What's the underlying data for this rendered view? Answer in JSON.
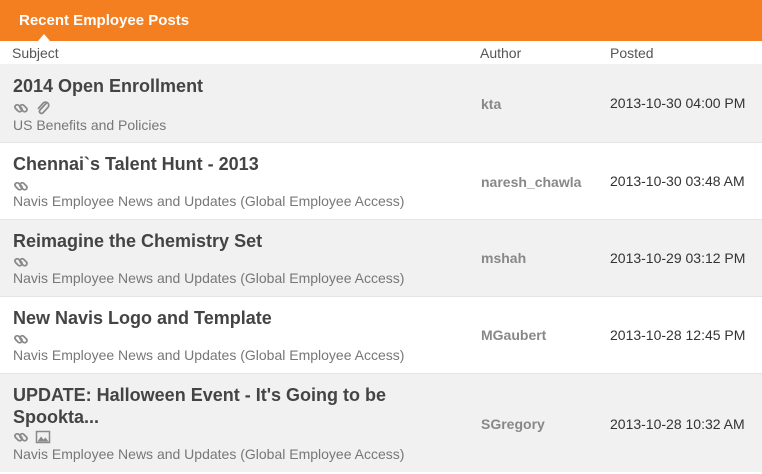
{
  "widget": {
    "title": "Recent Employee Posts",
    "accent_color": "#f47f20"
  },
  "columns": {
    "subject": "Subject",
    "author": "Author",
    "posted": "Posted"
  },
  "posts": [
    {
      "title": "2014 Open Enrollment",
      "category": "US Benefits and Policies",
      "author": "kta",
      "posted": "2013-10-30 04:00 PM",
      "icons": [
        "link-icon",
        "attachment-icon"
      ]
    },
    {
      "title": "Chennai`s Talent Hunt - 2013",
      "category": "Navis Employee News and Updates (Global Employee Access)",
      "author": "naresh_chawla",
      "posted": "2013-10-30 03:48 AM",
      "icons": [
        "link-icon"
      ]
    },
    {
      "title": "Reimagine the Chemistry Set",
      "category": "Navis Employee News and Updates (Global Employee Access)",
      "author": "mshah",
      "posted": "2013-10-29 03:12 PM",
      "icons": [
        "link-icon"
      ]
    },
    {
      "title": "New Navis Logo and Template",
      "category": "Navis Employee News and Updates (Global Employee Access)",
      "author": "MGaubert",
      "posted": "2013-10-28 12:45 PM",
      "icons": [
        "link-icon"
      ]
    },
    {
      "title_line1": "UPDATE: Halloween Event - It's Going to be",
      "title_line2": "Spookta...",
      "category": "Navis Employee News and Updates (Global Employee Access)",
      "author": "SGregory",
      "posted": "2013-10-28 10:32 AM",
      "icons": [
        "link-icon",
        "image-icon"
      ]
    }
  ]
}
